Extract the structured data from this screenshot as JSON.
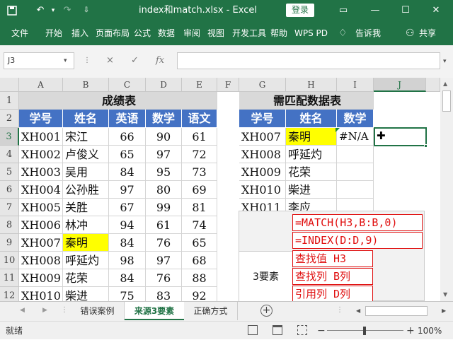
{
  "window": {
    "title": "index和match.xlsx  -  Excel",
    "login": "登录"
  },
  "ribbon_tabs": [
    "文件",
    "开始",
    "插入",
    "页面布局",
    "公式",
    "数据",
    "审阅",
    "视图",
    "开发工具",
    "帮助",
    "WPS PD",
    "告诉我",
    "共享"
  ],
  "namebox": "J3",
  "formula_icons": [
    "×",
    "✓",
    "fx"
  ],
  "columns": [
    "A",
    "B",
    "C",
    "D",
    "E",
    "F",
    "G",
    "H",
    "I",
    "J"
  ],
  "rows": [
    "1",
    "2",
    "3",
    "4",
    "5",
    "6",
    "7",
    "8",
    "9",
    "10",
    "11",
    "12"
  ],
  "left_table": {
    "title": "成绩表",
    "headers": [
      "学号",
      "姓名",
      "英语",
      "数学",
      "语文"
    ],
    "rows": [
      [
        "XH001",
        "宋江",
        "66",
        "90",
        "61"
      ],
      [
        "XH002",
        "卢俊义",
        "65",
        "97",
        "72"
      ],
      [
        "XH003",
        "吴用",
        "84",
        "95",
        "73"
      ],
      [
        "XH004",
        "公孙胜",
        "97",
        "80",
        "69"
      ],
      [
        "XH005",
        "关胜",
        "67",
        "99",
        "81"
      ],
      [
        "XH006",
        "林冲",
        "94",
        "61",
        "74"
      ],
      [
        "XH007",
        "秦明",
        "84",
        "76",
        "65"
      ],
      [
        "XH008",
        "呼延灼",
        "98",
        "97",
        "68"
      ],
      [
        "XH009",
        "花荣",
        "84",
        "76",
        "88"
      ],
      [
        "XH010",
        "柴进",
        "75",
        "83",
        "92"
      ]
    ]
  },
  "right_table": {
    "title": "需匹配数据表",
    "headers": [
      "学号",
      "姓名",
      "数学"
    ],
    "rows": [
      [
        "XH007",
        "秦明",
        "#N/A"
      ],
      [
        "XH008",
        "呼延灼",
        ""
      ],
      [
        "XH009",
        "花荣",
        ""
      ],
      [
        "XH010",
        "柴进",
        ""
      ],
      [
        "XH011",
        "李应",
        ""
      ]
    ]
  },
  "overlay": {
    "formula1": "=MATCH(H3,B:B,0)",
    "formula2": "=INDEX(D:D,9)",
    "label": "3要素",
    "item1": "查找值 H3",
    "item2": "查找列 B列",
    "item3": "引用列 D列"
  },
  "sheet_tabs": [
    "错误案例",
    "来源3要素",
    "正确方式"
  ],
  "active_sheet": "来源3要素",
  "status": {
    "ready": "就绪",
    "zoom": "100%"
  },
  "colors": {
    "excel_green": "#217346",
    "header_blue": "#4472c4",
    "highlight": "#ffff00",
    "formula_red": "#e01010"
  }
}
